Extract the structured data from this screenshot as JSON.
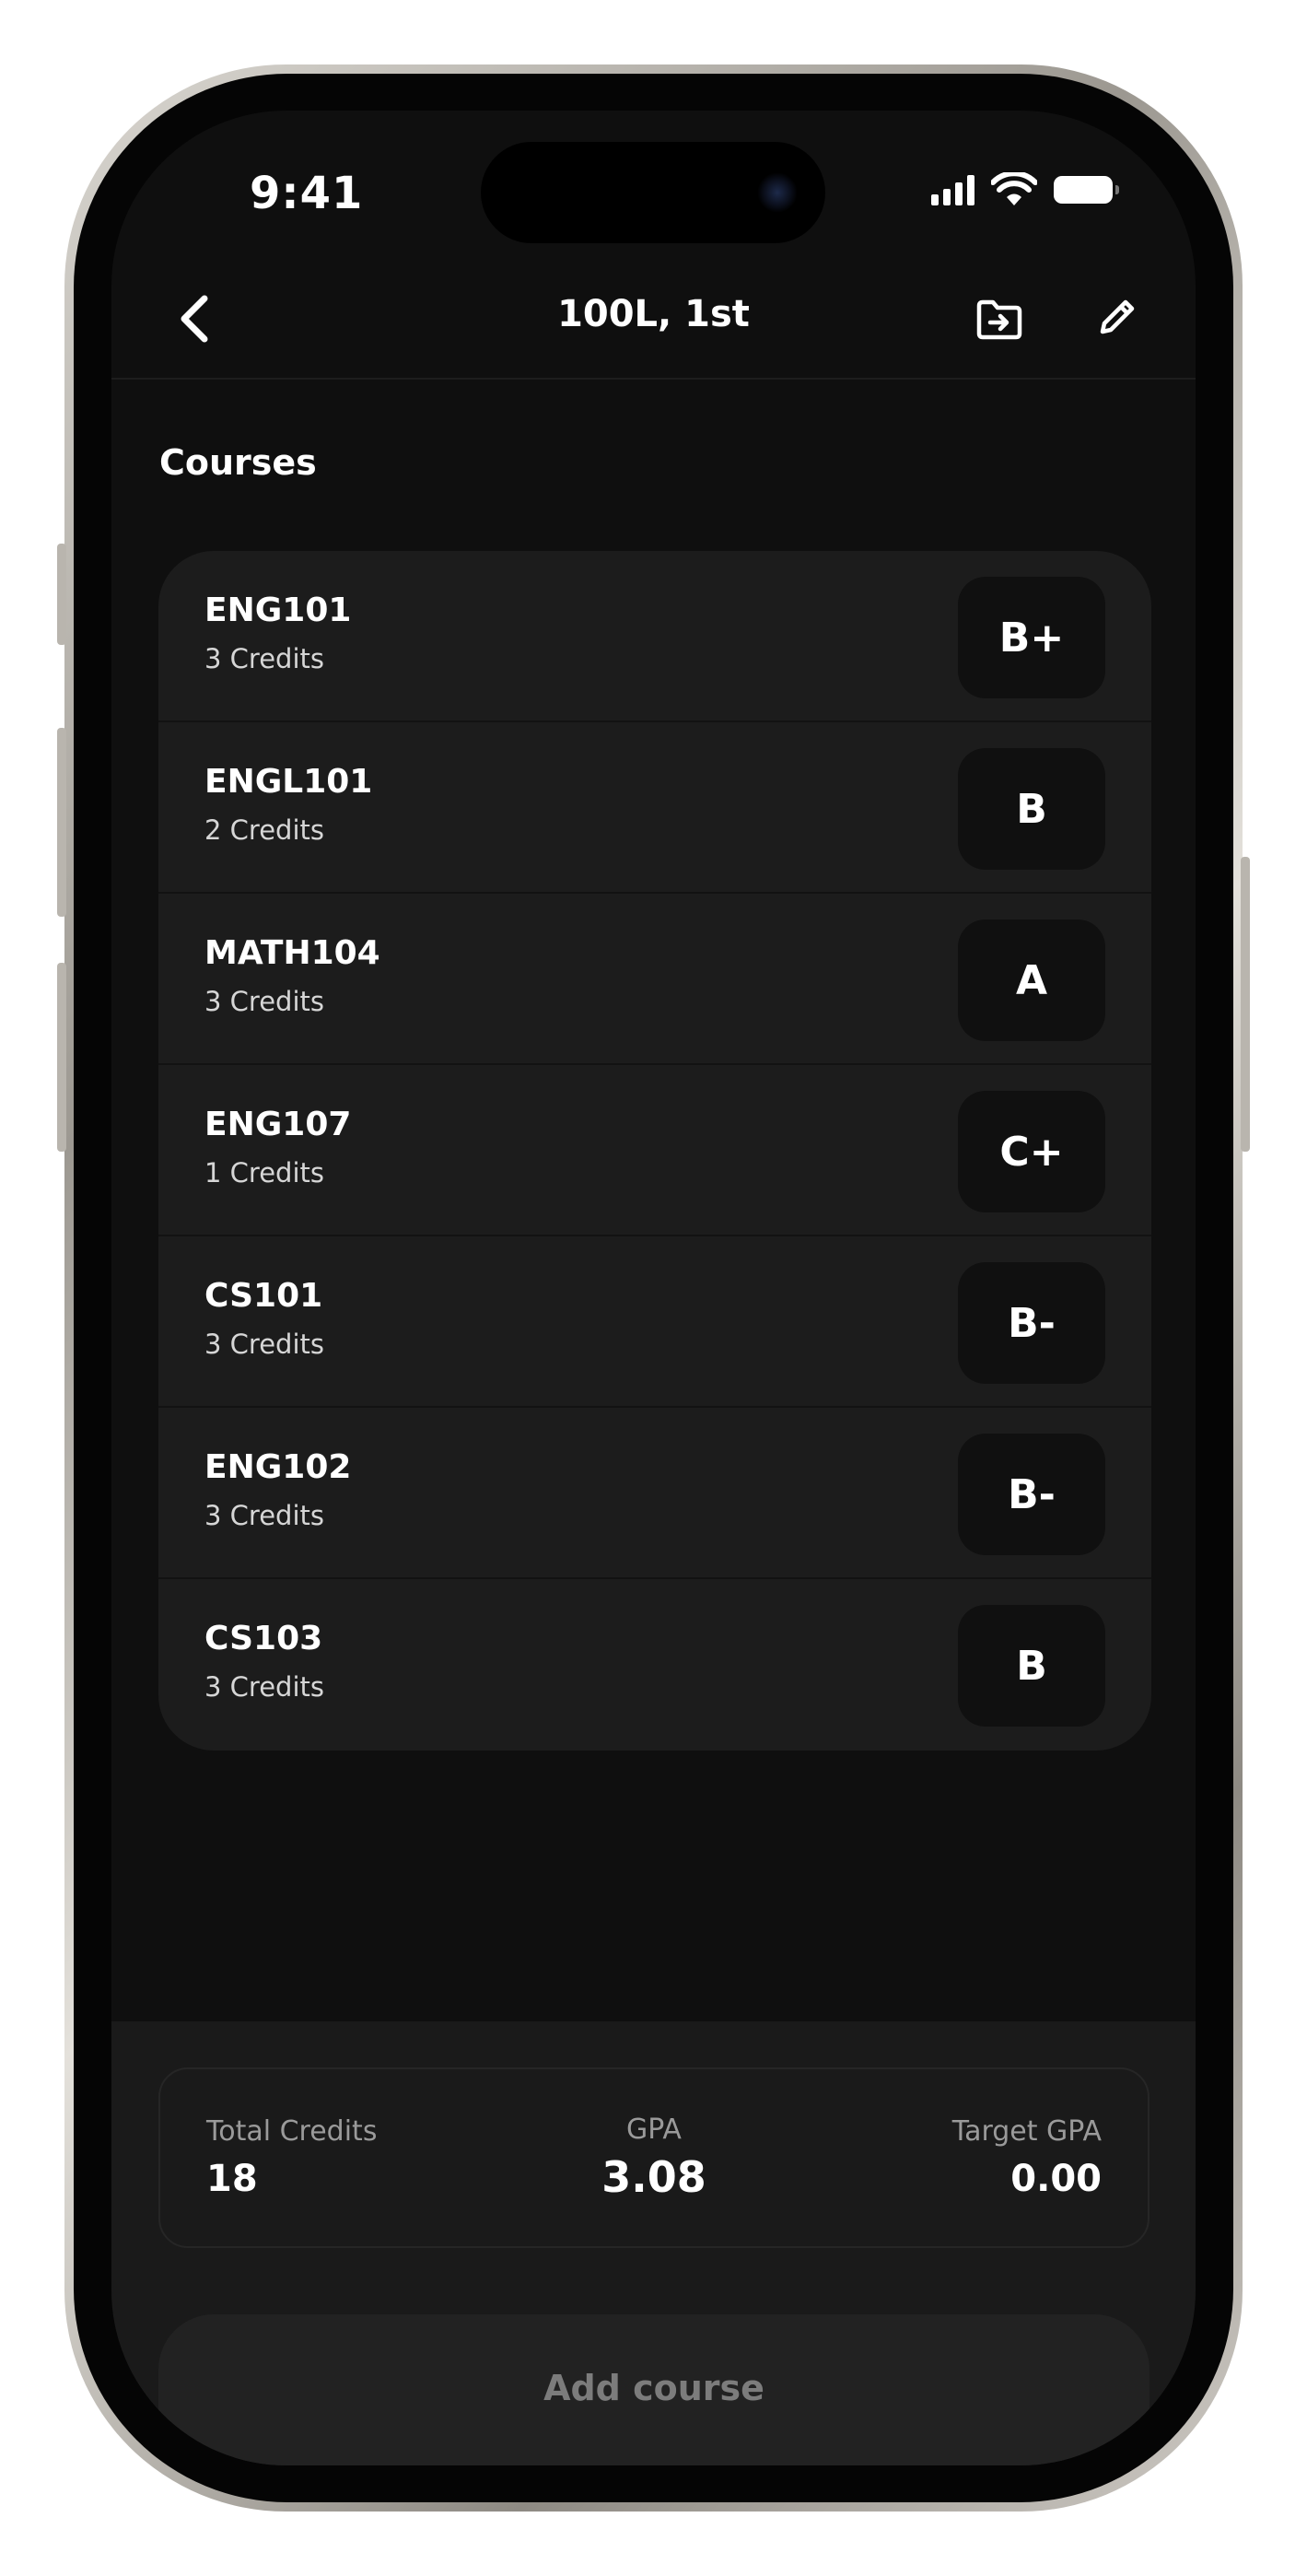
{
  "status_bar": {
    "time": "9:41"
  },
  "nav": {
    "title": "100L, 1st"
  },
  "section": {
    "title": "Courses"
  },
  "courses": [
    {
      "code": "ENG101",
      "credits": "3 Credits",
      "grade": "B+"
    },
    {
      "code": "ENGL101",
      "credits": "2 Credits",
      "grade": "B"
    },
    {
      "code": "MATH104",
      "credits": "3 Credits",
      "grade": "A"
    },
    {
      "code": "ENG107",
      "credits": "1 Credits",
      "grade": "C+"
    },
    {
      "code": "CS101",
      "credits": "3 Credits",
      "grade": "B-"
    },
    {
      "code": "ENG102",
      "credits": "3 Credits",
      "grade": "B-"
    },
    {
      "code": "CS103",
      "credits": "3 Credits",
      "grade": "B"
    }
  ],
  "summary": {
    "total_credits_label": "Total Credits",
    "total_credits_value": "18",
    "gpa_label": "GPA",
    "gpa_value": "3.08",
    "target_gpa_label": "Target GPA",
    "target_gpa_value": "0.00"
  },
  "actions": {
    "add_course_label": "Add course"
  },
  "icons": {
    "back": "chevron-left-icon",
    "export": "folder-import-icon",
    "edit": "pencil-icon",
    "signal": "cellular-signal-icon",
    "wifi": "wifi-icon",
    "battery": "battery-icon"
  },
  "colors": {
    "background": "#0f0f0f",
    "card": "#1c1c1c",
    "grade_box": "#101010",
    "panel": "#1a1a1a",
    "text_primary": "#ffffff",
    "text_muted": "#9a9a9a"
  }
}
